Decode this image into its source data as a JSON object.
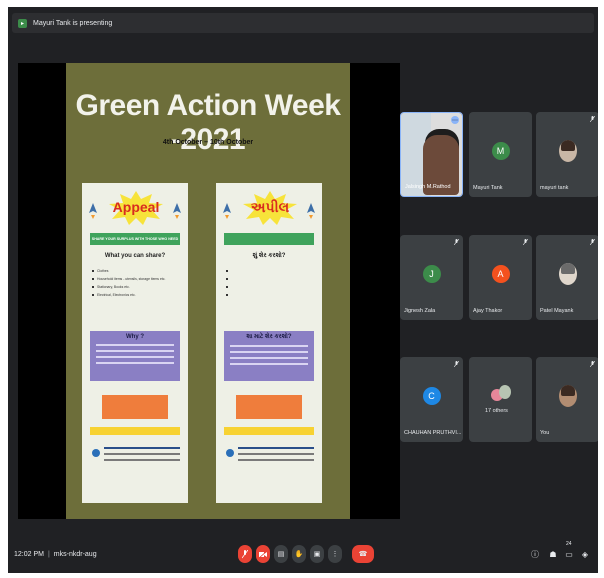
{
  "topbar": {
    "presenting_text": "Mayuri Tank is presenting"
  },
  "slide": {
    "title": "Green Action Week -2021",
    "dates": "4th October – 10th October",
    "poster_en": {
      "header": "Appeal",
      "band_text": "SHARE YOUR SURPLUS WITH THOSE WHO NEED",
      "share_heading": "What you can share?",
      "items": [
        "Clothes",
        "Household items - utensils, storage items etc.",
        "Stationary, Books etc.",
        "Electrical, Electronics etc."
      ],
      "why_heading": "Why ?"
    },
    "poster_gu": {
      "header": "અપીલ",
      "share_heading": "શું શેર કરશો?",
      "why_heading": "શા માટે શેર કરશો?"
    }
  },
  "participants": [
    {
      "name": "Jalsingh M.Rathod",
      "initial": "",
      "color": "",
      "self": true
    },
    {
      "name": "Mayuri Tank",
      "initial": "M",
      "color": "#3c8c4a"
    },
    {
      "name": "mayuri tank",
      "initial": "",
      "color": "",
      "photo": true
    },
    {
      "name": "Jignesh Zala",
      "initial": "J",
      "color": "#3c8c4a"
    },
    {
      "name": "Ajay Thakor",
      "initial": "A",
      "color": "#f4511e"
    },
    {
      "name": "Patel Mayank",
      "initial": "",
      "color": "",
      "photo": true
    },
    {
      "name": "CHAUHAN PRUTHVI...",
      "initial": "C",
      "color": "#1e88e5"
    },
    {
      "name": "17 others",
      "initial": "",
      "color": ""
    },
    {
      "name": "You",
      "initial": "",
      "color": "",
      "photo": true
    }
  ],
  "bottombar": {
    "time": "12:02 PM",
    "separator": "|",
    "meeting_code": "mks-nkdr-aug",
    "people_count": "24"
  },
  "colors": {
    "background": "#202124",
    "tile": "#3c4043",
    "end_call": "#ea4335",
    "accent": "#8ab4f8"
  }
}
